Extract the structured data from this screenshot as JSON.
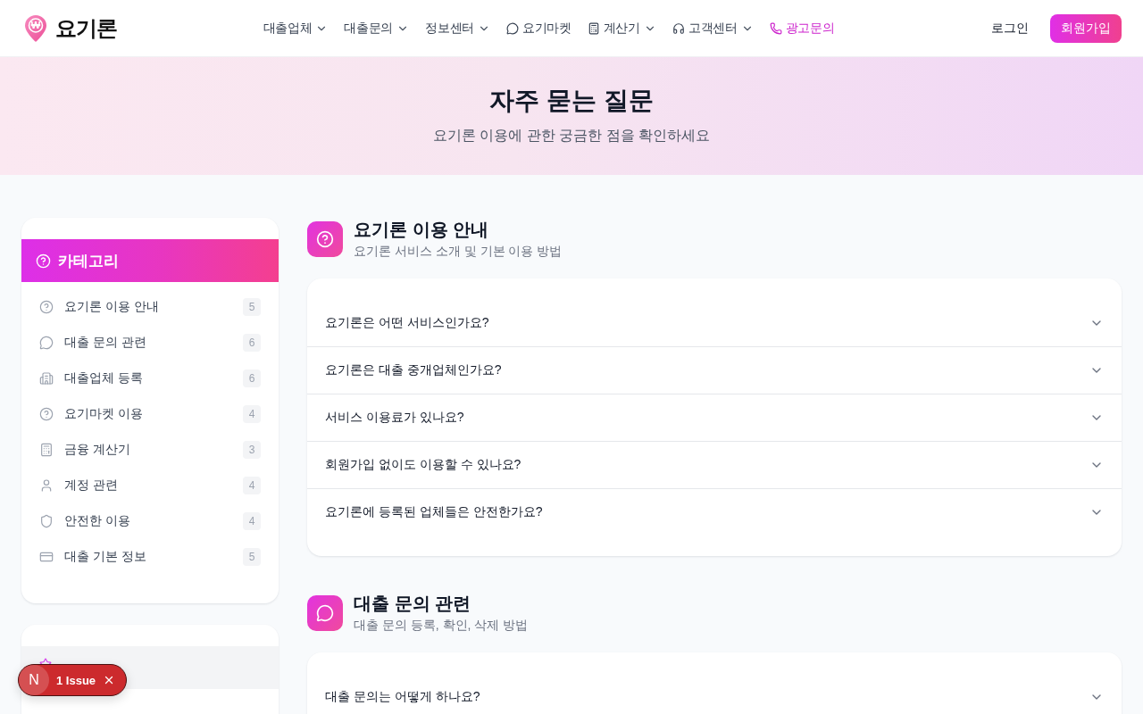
{
  "header": {
    "logo_symbol": "₩",
    "logo_text": "요기론",
    "nav": [
      {
        "label": "대출업체",
        "dropdown": true,
        "accent": false
      },
      {
        "label": "대출문의",
        "dropdown": true,
        "accent": false
      },
      {
        "label": "정보센터",
        "dropdown": true,
        "accent": false
      },
      {
        "label": "요기마켓",
        "dropdown": false,
        "accent": false
      },
      {
        "label": "계산기",
        "dropdown": true,
        "accent": false
      },
      {
        "label": "고객센터",
        "dropdown": true,
        "accent": false
      },
      {
        "label": "광고문의",
        "dropdown": false,
        "accent": true
      }
    ],
    "login": "로그인",
    "signup": "회원가입"
  },
  "hero": {
    "title": "자주 묻는 질문",
    "subtitle": "요기론 이용에 관한 궁금한 점을 확인하세요"
  },
  "sidebar": {
    "title": "카테고리",
    "categories": [
      {
        "label": "요기론 이용 안내",
        "count": "5",
        "selected": false
      },
      {
        "label": "대출 문의 관련",
        "count": "6",
        "selected": false
      },
      {
        "label": "대출업체 등록",
        "count": "6",
        "selected": false
      },
      {
        "label": "요기마켓 이용",
        "count": "4",
        "selected": false
      },
      {
        "label": "금융 계산기",
        "count": "3",
        "selected": false
      },
      {
        "label": "계정 관련",
        "count": "4",
        "selected": false
      },
      {
        "label": "안전한 이용",
        "count": "4",
        "selected": false
      },
      {
        "label": "대출 기본 정보",
        "count": "5",
        "selected": false
      }
    ]
  },
  "sections": [
    {
      "title": "요기론 이용 안내",
      "subtitle": "요기론 서비스 소개 및 기본 이용 방법",
      "questions": [
        {
          "text": "요기론은 어떤 서비스인가요?",
          "expanded": false
        },
        {
          "text": "요기론은 대출 중개업체인가요?",
          "expanded": false
        },
        {
          "text": "서비스 이용료가 있나요?",
          "expanded": false
        },
        {
          "text": "회원가입 없이도 이용할 수 있나요?",
          "expanded": false
        },
        {
          "text": "요기론에 등록된 업체들은 안전한가요?",
          "expanded": false
        }
      ]
    },
    {
      "title": "대출 문의 관련",
      "subtitle": "대출 문의 등록, 확인, 삭제 방법",
      "questions": [
        {
          "text": "대출 문의는 어떻게 하나요?",
          "expanded": false
        }
      ]
    }
  ],
  "issue_badge": {
    "letter": "N",
    "label": "1 Issue"
  }
}
